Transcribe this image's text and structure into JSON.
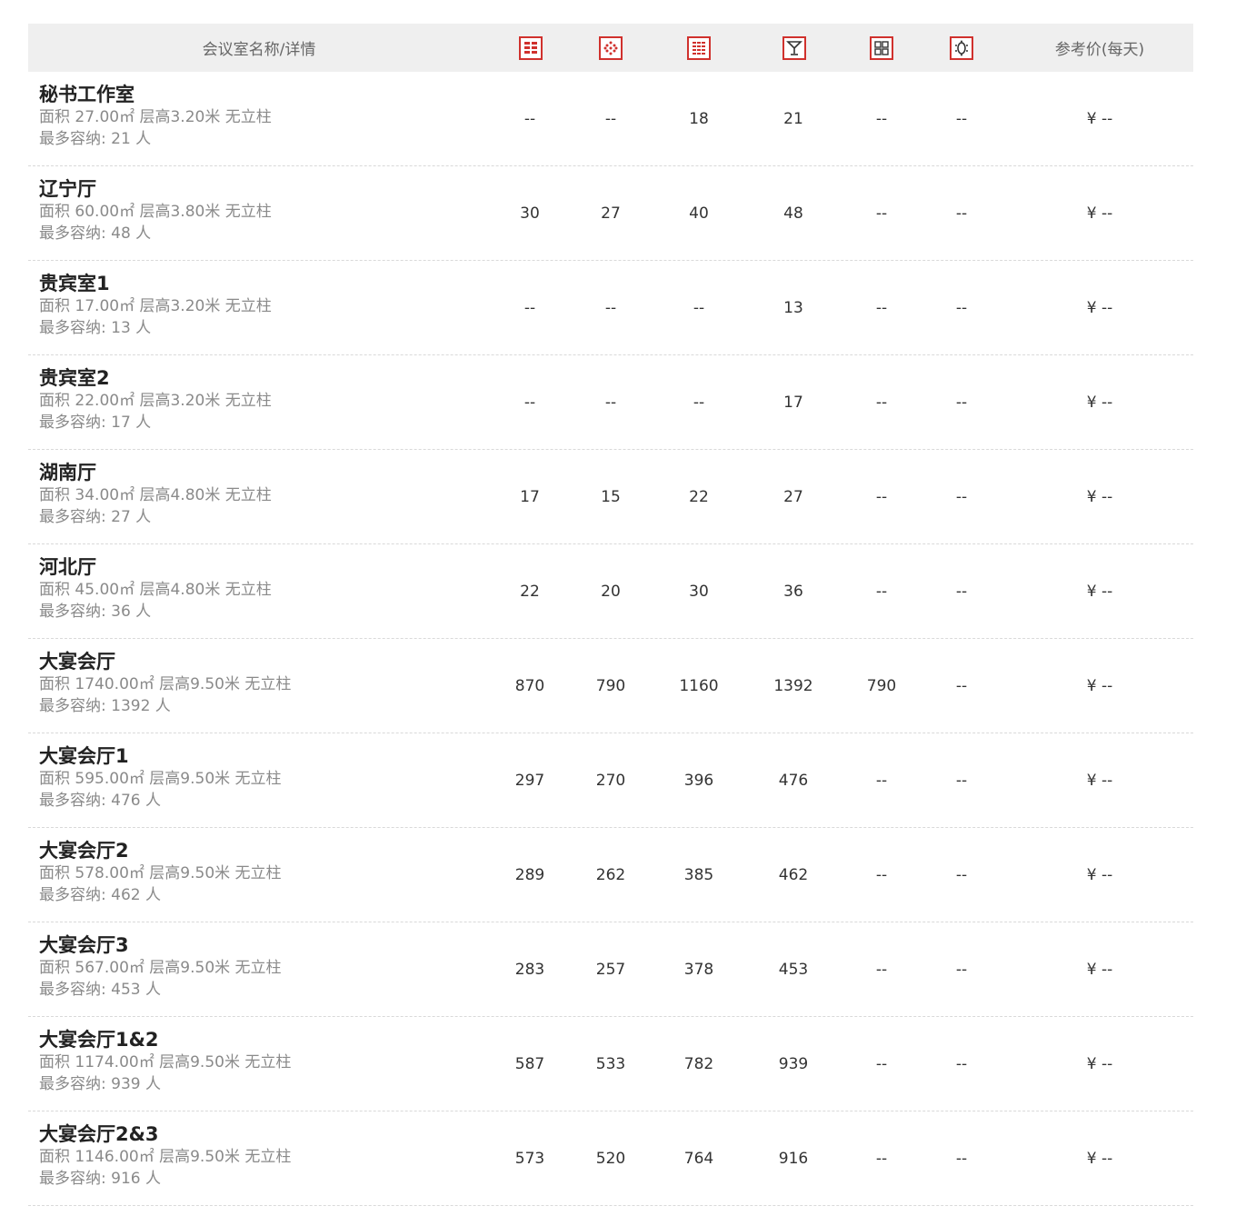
{
  "header": {
    "name_label": "会议室名称/详情",
    "price_label": "参考价(每天)",
    "layout_icons": [
      "theater-layout-icon",
      "banquet-layout-icon",
      "classroom-layout-icon",
      "cocktail-layout-icon",
      "u-shape-layout-icon",
      "boardroom-layout-icon"
    ]
  },
  "accent_color": "#d0312d",
  "rooms": [
    {
      "name": "秘书工作室",
      "area": "面积 27.00㎡ 层高3.20米 无立柱",
      "capacity": "最多容纳: 21 人",
      "cols": [
        "--",
        "--",
        "18",
        "21",
        "--",
        "--"
      ],
      "price": "¥ --"
    },
    {
      "name": "辽宁厅",
      "area": "面积 60.00㎡ 层高3.80米 无立柱",
      "capacity": "最多容纳: 48 人",
      "cols": [
        "30",
        "27",
        "40",
        "48",
        "--",
        "--"
      ],
      "price": "¥ --"
    },
    {
      "name": "贵宾室1",
      "area": "面积 17.00㎡ 层高3.20米 无立柱",
      "capacity": "最多容纳: 13 人",
      "cols": [
        "--",
        "--",
        "--",
        "13",
        "--",
        "--"
      ],
      "price": "¥ --"
    },
    {
      "name": "贵宾室2",
      "area": "面积 22.00㎡ 层高3.20米 无立柱",
      "capacity": "最多容纳: 17 人",
      "cols": [
        "--",
        "--",
        "--",
        "17",
        "--",
        "--"
      ],
      "price": "¥ --"
    },
    {
      "name": "湖南厅",
      "area": "面积 34.00㎡ 层高4.80米 无立柱",
      "capacity": "最多容纳: 27 人",
      "cols": [
        "17",
        "15",
        "22",
        "27",
        "--",
        "--"
      ],
      "price": "¥ --"
    },
    {
      "name": "河北厅",
      "area": "面积 45.00㎡ 层高4.80米 无立柱",
      "capacity": "最多容纳: 36 人",
      "cols": [
        "22",
        "20",
        "30",
        "36",
        "--",
        "--"
      ],
      "price": "¥ --"
    },
    {
      "name": "大宴会厅",
      "area": "面积 1740.00㎡ 层高9.50米 无立柱",
      "capacity": "最多容纳: 1392 人",
      "cols": [
        "870",
        "790",
        "1160",
        "1392",
        "790",
        "--"
      ],
      "price": "¥ --"
    },
    {
      "name": "大宴会厅1",
      "area": "面积 595.00㎡ 层高9.50米 无立柱",
      "capacity": "最多容纳: 476 人",
      "cols": [
        "297",
        "270",
        "396",
        "476",
        "--",
        "--"
      ],
      "price": "¥ --"
    },
    {
      "name": "大宴会厅2",
      "area": "面积 578.00㎡ 层高9.50米 无立柱",
      "capacity": "最多容纳: 462 人",
      "cols": [
        "289",
        "262",
        "385",
        "462",
        "--",
        "--"
      ],
      "price": "¥ --"
    },
    {
      "name": "大宴会厅3",
      "area": "面积 567.00㎡ 层高9.50米 无立柱",
      "capacity": "最多容纳: 453 人",
      "cols": [
        "283",
        "257",
        "378",
        "453",
        "--",
        "--"
      ],
      "price": "¥ --"
    },
    {
      "name": "大宴会厅1&2",
      "area": "面积 1174.00㎡ 层高9.50米 无立柱",
      "capacity": "最多容纳: 939 人",
      "cols": [
        "587",
        "533",
        "782",
        "939",
        "--",
        "--"
      ],
      "price": "¥ --"
    },
    {
      "name": "大宴会厅2&3",
      "area": "面积 1146.00㎡ 层高9.50米 无立柱",
      "capacity": "最多容纳: 916 人",
      "cols": [
        "573",
        "520",
        "764",
        "916",
        "--",
        "--"
      ],
      "price": "¥ --"
    }
  ]
}
